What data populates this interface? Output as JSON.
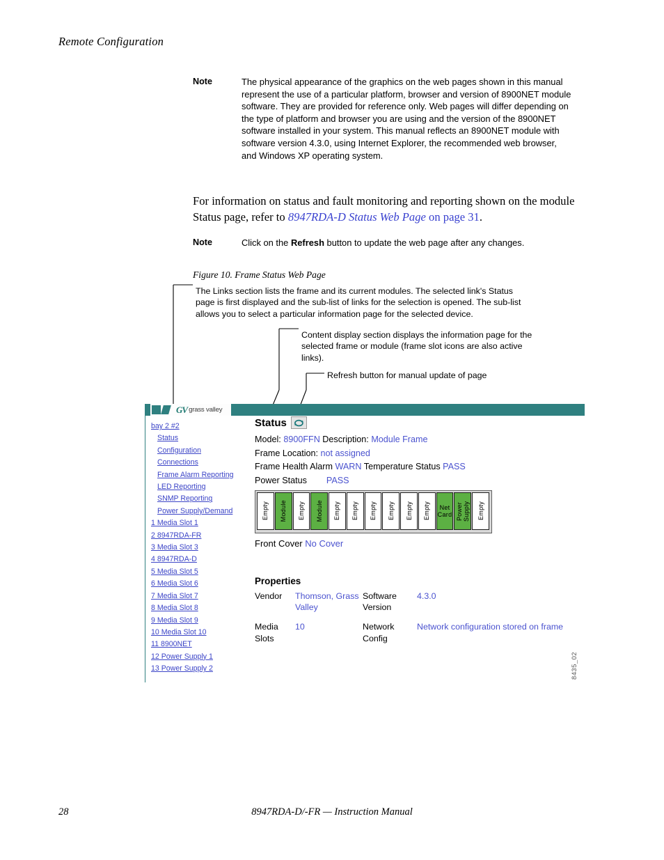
{
  "running_head": "Remote Configuration",
  "notes": [
    {
      "label": "Note",
      "body": "The physical appearance of the graphics on the web pages shown in this manual represent the use of a particular platform, browser and version of 8900NET module software. They are provided for reference only. Web pages will differ depending on the type of platform and browser you are using and the version of the 8900NET software installed in your system. This manual reflects an 8900NET module with software version 4.3.0, using Internet Explorer, the recommended web browser, and Windows XP operating system."
    }
  ],
  "paragraph": {
    "lead": "For information on status and fault monitoring and reporting shown on the module Status page, refer to ",
    "xref_italic": "8947RDA-D Status Web Page",
    "xref_tail": " on page 31",
    "period": "."
  },
  "note2": {
    "label": "Note",
    "pre": "Click on the ",
    "bold": "Refresh",
    "post": " button to update the web page after any changes."
  },
  "figure": {
    "caption": "Figure 10.  Frame Status Web Page",
    "id": "8435_02"
  },
  "callouts": [
    "The Links section lists the frame and its current modules. The selected link's Status page is first displayed and the sub-list of links for the selection is opened. The sub-list allows you to select a particular information page for the selected device.",
    "Content display section displays the information page for the selected frame or module (frame slot icons are also active links).",
    "Refresh button for manual update of page"
  ],
  "webpage": {
    "logo": {
      "mark": "GV",
      "word": "grass valley"
    },
    "links": [
      {
        "label": "bay 2 #2",
        "indent": false
      },
      {
        "label": "Status",
        "indent": true
      },
      {
        "label": "Configuration",
        "indent": true
      },
      {
        "label": "Connections",
        "indent": true
      },
      {
        "label": "Frame Alarm Reporting",
        "indent": true
      },
      {
        "label": "LED Reporting",
        "indent": true
      },
      {
        "label": "SNMP Reporting",
        "indent": true
      },
      {
        "label": "Power Supply/Demand",
        "indent": true
      },
      {
        "label": "1 Media Slot 1",
        "indent": false
      },
      {
        "label": "2  8947RDA-FR",
        "indent": false
      },
      {
        "label": "3 Media Slot 3",
        "indent": false
      },
      {
        "label": "4  8947RDA-D",
        "indent": false
      },
      {
        "label": "5 Media Slot 5",
        "indent": false
      },
      {
        "label": "6 Media Slot 6",
        "indent": false
      },
      {
        "label": "7 Media Slot 7",
        "indent": false
      },
      {
        "label": "8 Media Slot 8",
        "indent": false
      },
      {
        "label": "9 Media Slot 9",
        "indent": false
      },
      {
        "label": "10 Media Slot 10",
        "indent": false
      },
      {
        "label": "11 8900NET",
        "indent": false
      },
      {
        "label": "12 Power Supply 1",
        "indent": false
      },
      {
        "label": "13 Power Supply 2",
        "indent": false
      }
    ],
    "status": {
      "title": "Status",
      "refresh_icon": "refresh-icon",
      "model_key": "Model: ",
      "model_val": "8900FFN",
      "desc_key": " Description: ",
      "desc_val": "Module Frame",
      "location_key": "Frame Location: ",
      "location_val": "not assigned",
      "health_key": "Frame Health Alarm ",
      "health_val": "WARN",
      "temp_key": " Temperature Status ",
      "temp_val": "PASS",
      "power_key": "Power Status        ",
      "power_val": "PASS",
      "front_cover_key": "Front Cover ",
      "front_cover_val": "No Cover"
    },
    "slots": [
      {
        "label": "Empty",
        "state": "empty"
      },
      {
        "label": "Module",
        "state": "filled"
      },
      {
        "label": "Empty",
        "state": "empty"
      },
      {
        "label": "Module",
        "state": "filled"
      },
      {
        "label": "Empty",
        "state": "empty"
      },
      {
        "label": "Empty",
        "state": "empty"
      },
      {
        "label": "Empty",
        "state": "empty"
      },
      {
        "label": "Empty",
        "state": "empty"
      },
      {
        "label": "Empty",
        "state": "empty"
      },
      {
        "label": "Empty",
        "state": "empty"
      },
      {
        "label": "Net\nCard",
        "state": "filled"
      },
      {
        "label": "Power Supply",
        "state": "filled"
      },
      {
        "label": "Empty",
        "state": "empty"
      }
    ],
    "properties": {
      "title": "Properties",
      "rows": [
        {
          "k": "Vendor",
          "v": "Thomson, Grass Valley",
          "k2": "Software Version",
          "v2": "4.3.0"
        },
        {
          "k": "Media Slots",
          "v": "10",
          "k2": "Network Config",
          "v2": "Network configuration stored on frame"
        }
      ]
    }
  },
  "footer": {
    "page_number": "28",
    "title": "8947RDA-D/-FR — Instruction Manual"
  },
  "colors": {
    "teal": "#2f8080",
    "link_blue": "#3b44c7",
    "value_blue": "#4a52cf",
    "slot_green": "#5cb043",
    "xref_blue": "#3840cf"
  }
}
